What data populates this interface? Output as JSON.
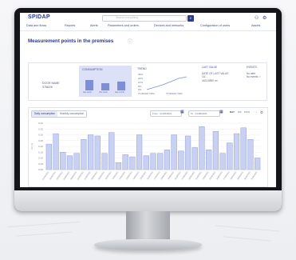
{
  "header": {
    "logo": "SPIDAP",
    "search_placeholder": "Search everything",
    "nav": [
      "Data and flows",
      "Reports",
      "Alerts",
      "Parameters and orders",
      "Devices and networks",
      "Configuration of users",
      "Assets"
    ]
  },
  "page": {
    "title": "Measurement points in the premises",
    "point_name": [
      "DOOR NAME",
      "3756/26"
    ]
  },
  "cards": {
    "consumption": {
      "title": "CONSUMPTION",
      "captions": [
        "last week",
        "this week",
        "last month"
      ],
      "levels": [
        0.55,
        0.35,
        0.45
      ]
    },
    "trend": {
      "title": "TREND",
      "axis": [
        "35%",
        "20%",
        "10%",
        "5%",
        "0%"
      ],
      "footer": [
        "TS 08/2021 TRIM",
        "TS 08/2021 TRIM"
      ]
    },
    "last_value": {
      "title": "LAST VALUE",
      "lines": [
        "DATE OF LAST VALUE",
        "14/...",
        "4423.6890 m³"
      ]
    },
    "events": {
      "title": "EVENTS",
      "lines": [
        "No alert",
        "No events ✓"
      ]
    }
  },
  "chart_panel": {
    "toggle": [
      "Daily consumption",
      "Monthly consumption"
    ],
    "from_label": "From : 01/08/2021",
    "to_label": "To : 31/08/2021",
    "segments": [
      "DAY",
      "WK",
      "MON"
    ],
    "colors": {
      "bar_fill": "#c9d1f2",
      "bar_stroke": "#7f8fd6",
      "accent": "#2b3a8c"
    }
  },
  "chart_data": {
    "type": "bar",
    "title": "",
    "xlabel": "",
    "ylabel": "m³ / d",
    "ylim": [
      0,
      0.4
    ],
    "yticks": [
      "0.40",
      "0.35",
      "0.30",
      "0.25",
      "0.20",
      "0.15",
      "0.10",
      "0.05",
      "0.00"
    ],
    "categories": [
      "01/08/2021",
      "02/08/2021",
      "03/08/2021",
      "04/08/2021",
      "05/08/2021",
      "06/08/2021",
      "07/08/2021",
      "08/08/2021",
      "09/08/2021",
      "10/08/2021",
      "11/08/2021",
      "12/08/2021",
      "13/08/2021",
      "14/08/2021",
      "15/08/2021",
      "16/08/2021",
      "17/08/2021",
      "18/08/2021",
      "19/08/2021",
      "20/08/2021",
      "21/08/2021",
      "22/08/2021",
      "23/08/2021",
      "24/08/2021",
      "25/08/2021",
      "26/08/2021",
      "27/08/2021",
      "28/08/2021",
      "29/08/2021",
      "30/08/2021",
      "31/08/2021"
    ],
    "values": [
      0.22,
      0.31,
      0.15,
      0.12,
      0.14,
      0.26,
      0.3,
      0.29,
      0.14,
      0.32,
      0.06,
      0.13,
      0.11,
      0.3,
      0.12,
      0.14,
      0.14,
      0.17,
      0.3,
      0.16,
      0.29,
      0.19,
      0.37,
      0.17,
      0.33,
      0.14,
      0.23,
      0.31,
      0.36,
      0.26,
      0.1
    ]
  }
}
